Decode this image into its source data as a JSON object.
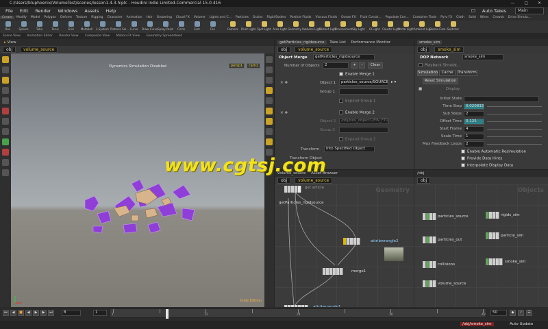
{
  "app": {
    "title": "C:/Users/bluphoenix/VolumeTest/scenes/lesson1.4.3.hiplc - Houdini Indie Limited-Commercial 15.0.416",
    "menu": [
      "File",
      "Edit",
      "Render",
      "Windows",
      "Assets",
      "Help"
    ],
    "auto_takes": "Auto Takes",
    "desktop": "Main"
  },
  "shelf": {
    "tabs": [
      "Create",
      "Modify",
      "Model",
      "Polygon",
      "Deform",
      "Texture",
      "Rigging",
      "Character",
      "Animation",
      "Hair",
      "Grooming",
      "Cloud FX",
      "Volume",
      "Lights and C...",
      "Particles",
      "Grains",
      "Rigid Bodies",
      "Particle Fluids",
      "Viscous Fluids",
      "Ocean FX",
      "Fluid Contai...",
      "Populate Con...",
      "Container Tools",
      "Pyro FX",
      "Cloth",
      "Solid",
      "Wires",
      "Crowds",
      "Drive Simula..."
    ],
    "tools_left": [
      "Box",
      "Sphere",
      "Tube",
      "Torus",
      "Grid",
      "Metaball",
      "L-System",
      "Platonic Sol...",
      "Curve",
      "Draw Curve",
      "Spray Paint",
      "Circle",
      "Font",
      "File"
    ],
    "tools_right": [
      "Camera",
      "Point Light",
      "Spot Light",
      "Area Light",
      "Geometry L...",
      "Volume Light",
      "Distant Light",
      "Environment...",
      "Sky Light",
      "GI Light",
      "Caustic Light",
      "Portal Light",
      "Ambient Lig...",
      "Stereo Cam...",
      "Switcher"
    ]
  },
  "pane_tabs": [
    "Scene View",
    "Animation Editor",
    "Render View",
    "Composite View",
    "Motion FX View",
    "Geometry Spreadsheet"
  ],
  "viewport": {
    "tab": "View",
    "path_obj": "obj",
    "path_node": "volume_source",
    "header": "Dynamics Simulation Disabled",
    "persp": "persp1",
    "cam": "cam1",
    "watermark_corner": "Indie Edition"
  },
  "param_merge": {
    "tab": "getParticles_rigidsource",
    "tab2": "Take List",
    "tab3": "Performance Monitor",
    "path_obj": "obj",
    "path_node": "volume_source",
    "type": "Object Merge",
    "name": "getParticles_rigidsource",
    "num_label": "Number of Objects",
    "num_value": "2",
    "plus": "+",
    "minus": "-",
    "clear": "Clear",
    "enable1": "Enable Merge 1",
    "object1_label": "Object 1",
    "object1_value": "particles_source/SOURCE",
    "group1_label": "Group 1",
    "expand1": "Expand Group 1",
    "enable2": "Enable Merge 2",
    "object2_label": "Object 2",
    "object2_value": "/obj/box_object1/FIN_FT1",
    "group2_label": "Group 2",
    "expand2": "Expand Group 2",
    "transform_label": "Transform",
    "transform_value": "Into Specified Object",
    "transform_obj_label": "Transform Object"
  },
  "param_dop": {
    "tab": "smoke_sim",
    "path_obj": "obj",
    "path_node": "smoke_sim",
    "type": "DOP Network",
    "name": "smoke_sim",
    "playback": "Playback Simulat...",
    "subtabs": [
      "Simulation",
      "Cache",
      "Transform"
    ],
    "reset": "Reset Simulation",
    "display": "Display",
    "rows": [
      {
        "label": "Initial State",
        "value": ""
      },
      {
        "label": "Time Step",
        "value": "0.0208333"
      },
      {
        "label": "Sub Steps",
        "value": "2"
      },
      {
        "label": "Offset Time",
        "value": "0.125"
      },
      {
        "label": "Start Frame",
        "value": "4"
      },
      {
        "label": "Scale Time",
        "value": "1"
      },
      {
        "label": "Max Feedback Loops",
        "value": "2"
      }
    ],
    "checks": [
      "Enable Automatic Resimulation",
      "Provide Data Hints",
      "Interpolate Display Data"
    ]
  },
  "net_left": {
    "tab": "volume_source",
    "tab2": "Asset Browser",
    "path_obj": "obj",
    "path_node": "volume_source",
    "corner": "Geometry",
    "nodes": [
      {
        "label": "getParticles_rigidsource",
        "short": "get article"
      },
      {
        "label": "attribwrangle2"
      },
      {
        "label": "merge1"
      },
      {
        "label": "attribwrangle1"
      }
    ]
  },
  "net_right": {
    "path": "/obj",
    "path_obj": "obj",
    "corner": "Objects",
    "nodes": [
      "particles_source",
      "particles_out",
      "collisions",
      "volume_source",
      "rigids_sim",
      "particle_sim",
      "smoke_sim"
    ]
  },
  "timeline": {
    "frame": "8",
    "start": "1",
    "end": "50",
    "ticks": [
      "1",
      "",
      "12",
      "",
      "24",
      "",
      "36",
      "",
      "48"
    ]
  },
  "status": {
    "path": "/obj/smoke_sim",
    "auto_update": "Auto Update"
  },
  "watermark": "www.cgtsj.com",
  "colors": {
    "accent": "#2f7f86",
    "node_hilite": "#d9b800",
    "selected_node": "#61a35a",
    "particles": "#8f3fd8",
    "mesh": "#d8b48d"
  }
}
